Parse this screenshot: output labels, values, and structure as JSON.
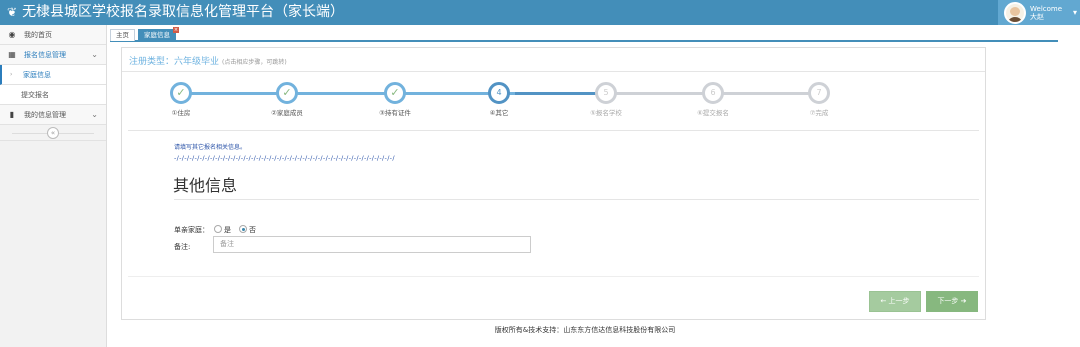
{
  "header": {
    "title": "无棣县城区学校报名录取信息化管理平台（家长端）",
    "welcome": "Welcome",
    "username": "大赵"
  },
  "sidebar": {
    "items": [
      {
        "label": "我的首页",
        "icon": "tachometer-icon"
      },
      {
        "label": "报名信息管理",
        "icon": "film-icon"
      },
      {
        "label": "家庭信息",
        "sub": true,
        "active": true
      },
      {
        "label": "提交报名",
        "sub": true
      },
      {
        "label": "我的信息管理",
        "icon": "book-icon"
      }
    ]
  },
  "tabs": [
    {
      "label": "主页"
    },
    {
      "label": "家庭信息"
    }
  ],
  "panel": {
    "title": "注册类型：六年级毕业",
    "hint": "(点击相应步骤，可跳转)"
  },
  "steps": [
    {
      "num": "1",
      "label": "①住房",
      "state": "done"
    },
    {
      "num": "2",
      "label": "②家庭成员",
      "state": "done"
    },
    {
      "num": "3",
      "label": "③持有证件",
      "state": "done"
    },
    {
      "num": "4",
      "label": "④其它",
      "state": "current"
    },
    {
      "num": "5",
      "label": "⑤报名学校",
      "state": "future"
    },
    {
      "num": "6",
      "label": "⑥提交报名",
      "state": "future"
    },
    {
      "num": "7",
      "label": "⑦完成",
      "state": "future"
    }
  ],
  "content": {
    "notice": "请填写其它报名相关信息。",
    "dashes": "-/-/-/-/-/-/-/-/-/-/-/-/-/-/-/-/-/-/-/-/-/-/-/-/-/-/-/-/-/-/-/-/-/-/-/-/-/-/-/-/-/-/-/",
    "section_title": "其他信息",
    "single_parent_label": "单亲家庭：",
    "option_yes": "是",
    "option_no": "否",
    "selected": "否",
    "remark_label": "备注:",
    "remark_placeholder": "备注"
  },
  "buttons": {
    "prev": "上一步",
    "next": "下一步"
  },
  "footer": {
    "text": "版权所有&技术支持：山东东方信达信息科技股份有限公司"
  },
  "colors": {
    "header": "#438eb9",
    "step_done": "#72b2dd",
    "button": "#87b87f"
  }
}
